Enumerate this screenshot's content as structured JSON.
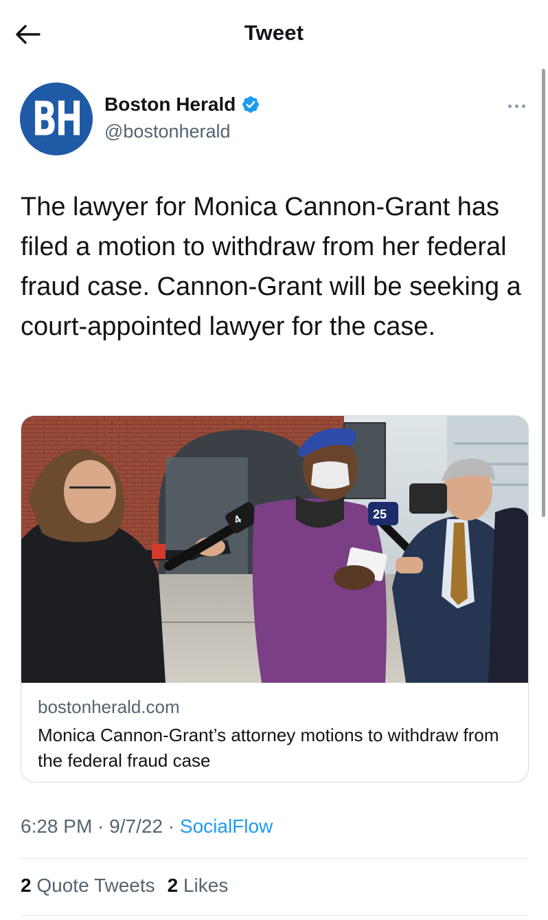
{
  "header": {
    "title": "Tweet",
    "back_icon": "arrow-left-icon"
  },
  "author": {
    "avatar_text": "BH",
    "name": "Boston Herald",
    "handle": "@bostonherald",
    "verified_icon": "verified-badge-icon"
  },
  "more_icon": "more-horizontal-icon",
  "tweet": {
    "text": "The lawyer for Monica Cannon-Grant has filed a motion to withdraw from her federal fraud case. Cannon-Grant will be seeking a court-appointed lawyer for the case."
  },
  "card": {
    "domain": "bostonherald.com",
    "title": "Monica Cannon-Grant’s attorney motions to withdraw from the federal fraud case",
    "image_mic_labels": [
      "4",
      "25"
    ]
  },
  "meta": {
    "time": "6:28 PM",
    "sep1": " · ",
    "date": "9/7/22",
    "sep2": " · ",
    "source": "SocialFlow"
  },
  "stats": {
    "quote_count": "2",
    "quote_label": "Quote Tweets",
    "like_count": "2",
    "like_label": "Likes"
  },
  "colors": {
    "accent": "#1d9bf0",
    "secondary_text": "#536471",
    "brand_blue": "#1f5aa6"
  }
}
